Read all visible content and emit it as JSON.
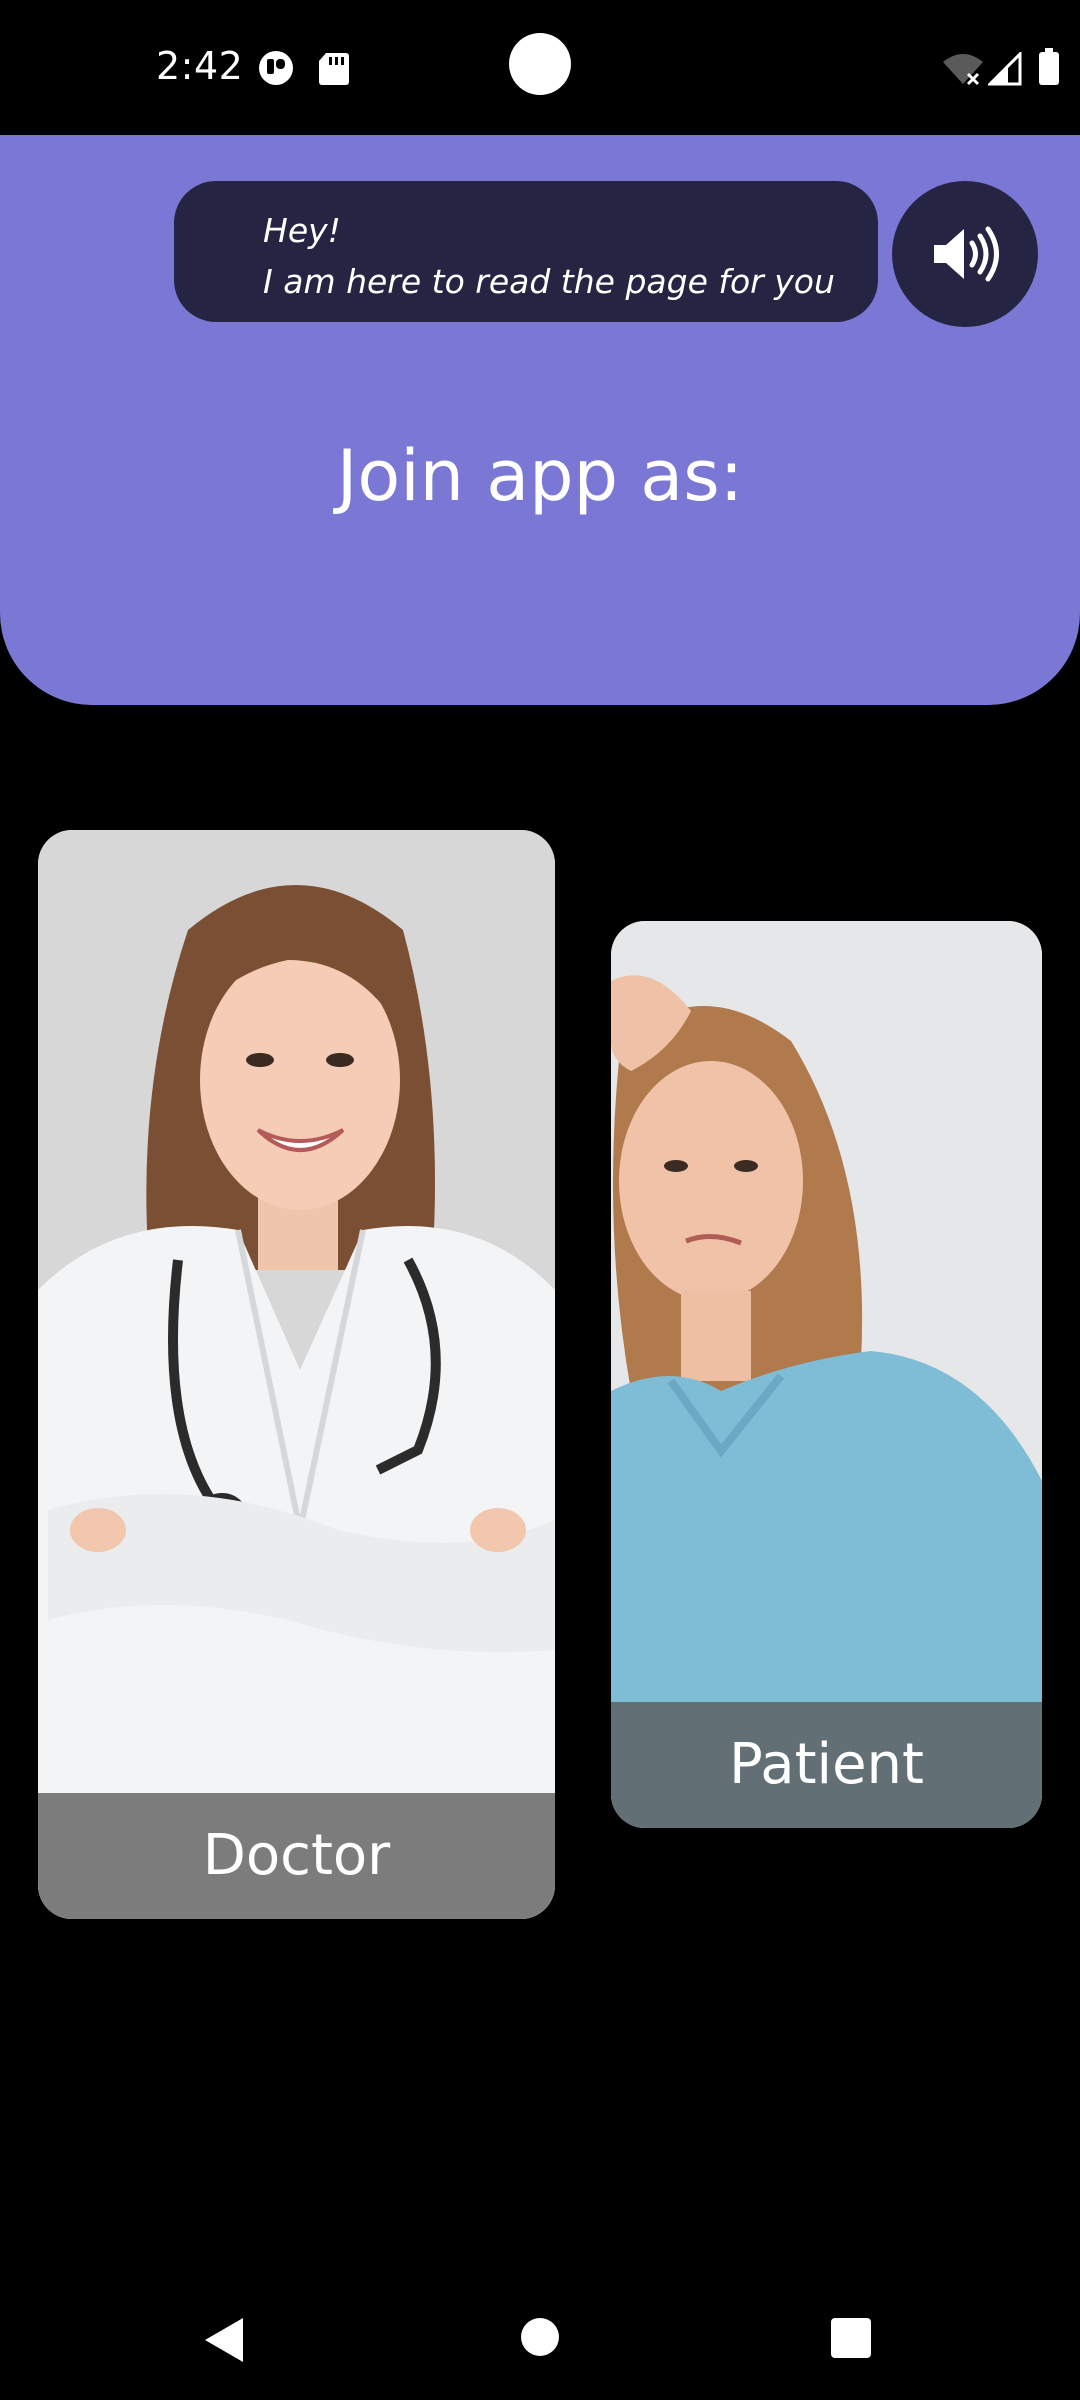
{
  "status_bar": {
    "time": "2:42",
    "icons": [
      "app-notification-icon",
      "sd-card-icon",
      "wifi-off-icon",
      "cell-signal-icon",
      "battery-icon"
    ]
  },
  "header": {
    "bubble_line_1": "Hey!",
    "bubble_line_2": "I am here to read the page for you",
    "speaker_icon": "speaker-volume-icon",
    "title": "Join app as:",
    "background_color": "#7b77d4",
    "bubble_color": "#262443"
  },
  "roles": [
    {
      "label": "Doctor"
    },
    {
      "label": "Patient"
    }
  ],
  "nav_bar": {
    "icons": [
      "back-icon",
      "home-icon",
      "recents-icon"
    ]
  }
}
